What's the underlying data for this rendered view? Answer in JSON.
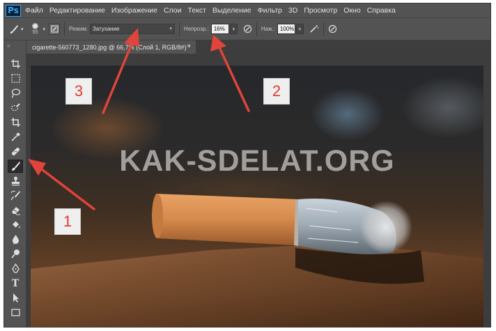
{
  "app": {
    "logo": "Ps"
  },
  "menu": [
    "Файл",
    "Редактирование",
    "Изображение",
    "Слои",
    "Текст",
    "Выделение",
    "Фильтр",
    "3D",
    "Просмотр",
    "Окно",
    "Справка"
  ],
  "options": {
    "brush_size": "55",
    "mode_label": "Режим:",
    "mode_value": "Затухание",
    "opacity_label": "Непрозр.:",
    "opacity_value": "16%",
    "flow_label": "Наж.:",
    "flow_value": "100%"
  },
  "document": {
    "tab_title": "cigarette-560773_1280.jpg @ 66,7% (Слой 1, RGB/8#) *",
    "close_glyph": "×"
  },
  "toolbar": {
    "tools": [
      "crop-icon",
      "marquee-icon",
      "lasso-icon",
      "quick-select-icon",
      "crop-tool-icon",
      "eyedropper-icon",
      "healing-brush-icon",
      "brush-icon",
      "clone-stamp-icon",
      "history-brush-icon",
      "eraser-icon",
      "paint-bucket-icon",
      "blur-icon",
      "dodge-icon",
      "pen-icon",
      "type-icon",
      "path-select-icon",
      "rectangle-icon",
      "hand-icon",
      "zoom-icon"
    ],
    "active_tool": "brush-icon",
    "type_glyph": "T"
  },
  "canvas": {
    "watermark": "KAK-SDELAT.ORG"
  },
  "annotations": {
    "box_1": "1",
    "box_2": "2",
    "box_3": "3",
    "arrow_color": "#e0443a"
  }
}
